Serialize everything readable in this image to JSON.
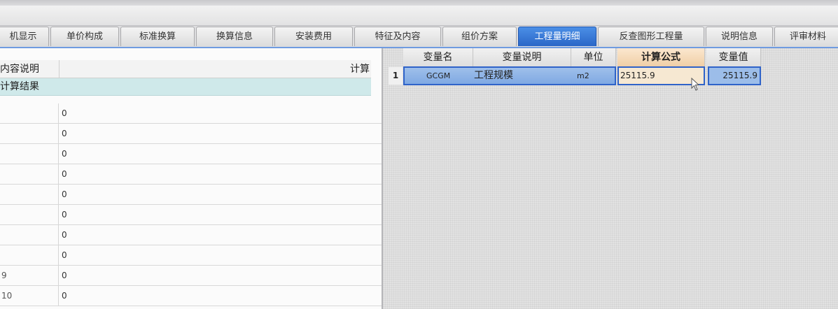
{
  "tabs": [
    {
      "label": "机显示"
    },
    {
      "label": "单价构成"
    },
    {
      "label": "标准换算"
    },
    {
      "label": "换算信息"
    },
    {
      "label": "安装费用"
    },
    {
      "label": "特征及内容"
    },
    {
      "label": "组价方案"
    },
    {
      "label": "工程量明细"
    },
    {
      "label": "反查图形工程量"
    },
    {
      "label": "说明信息"
    },
    {
      "label": "评审材料"
    }
  ],
  "left": {
    "header_label": "内容说明",
    "header_right": "计算",
    "result_label": "计算结果",
    "rows": [
      {
        "num": "",
        "value": "0"
      },
      {
        "num": "",
        "value": "0"
      },
      {
        "num": "",
        "value": "0"
      },
      {
        "num": "",
        "value": "0"
      },
      {
        "num": "",
        "value": "0"
      },
      {
        "num": "",
        "value": "0"
      },
      {
        "num": "",
        "value": "0"
      },
      {
        "num": "",
        "value": "0"
      },
      {
        "num": "9",
        "value": "0"
      },
      {
        "num": "10",
        "value": "0"
      }
    ]
  },
  "right": {
    "columns": {
      "name": "变量名",
      "desc": "变量说明",
      "unit": "单位",
      "formula": "计算公式",
      "value": "变量值"
    },
    "row": {
      "num": "1",
      "name": "GCGM",
      "desc": "工程规模",
      "unit": "m2",
      "formula": "25115.9",
      "value": "25115.9"
    }
  },
  "colors": {
    "active_tab": "#2a66c7",
    "selection_border": "#2f63c9",
    "formula_header": "#f0cfa6",
    "result_row": "#cfe9ea"
  }
}
